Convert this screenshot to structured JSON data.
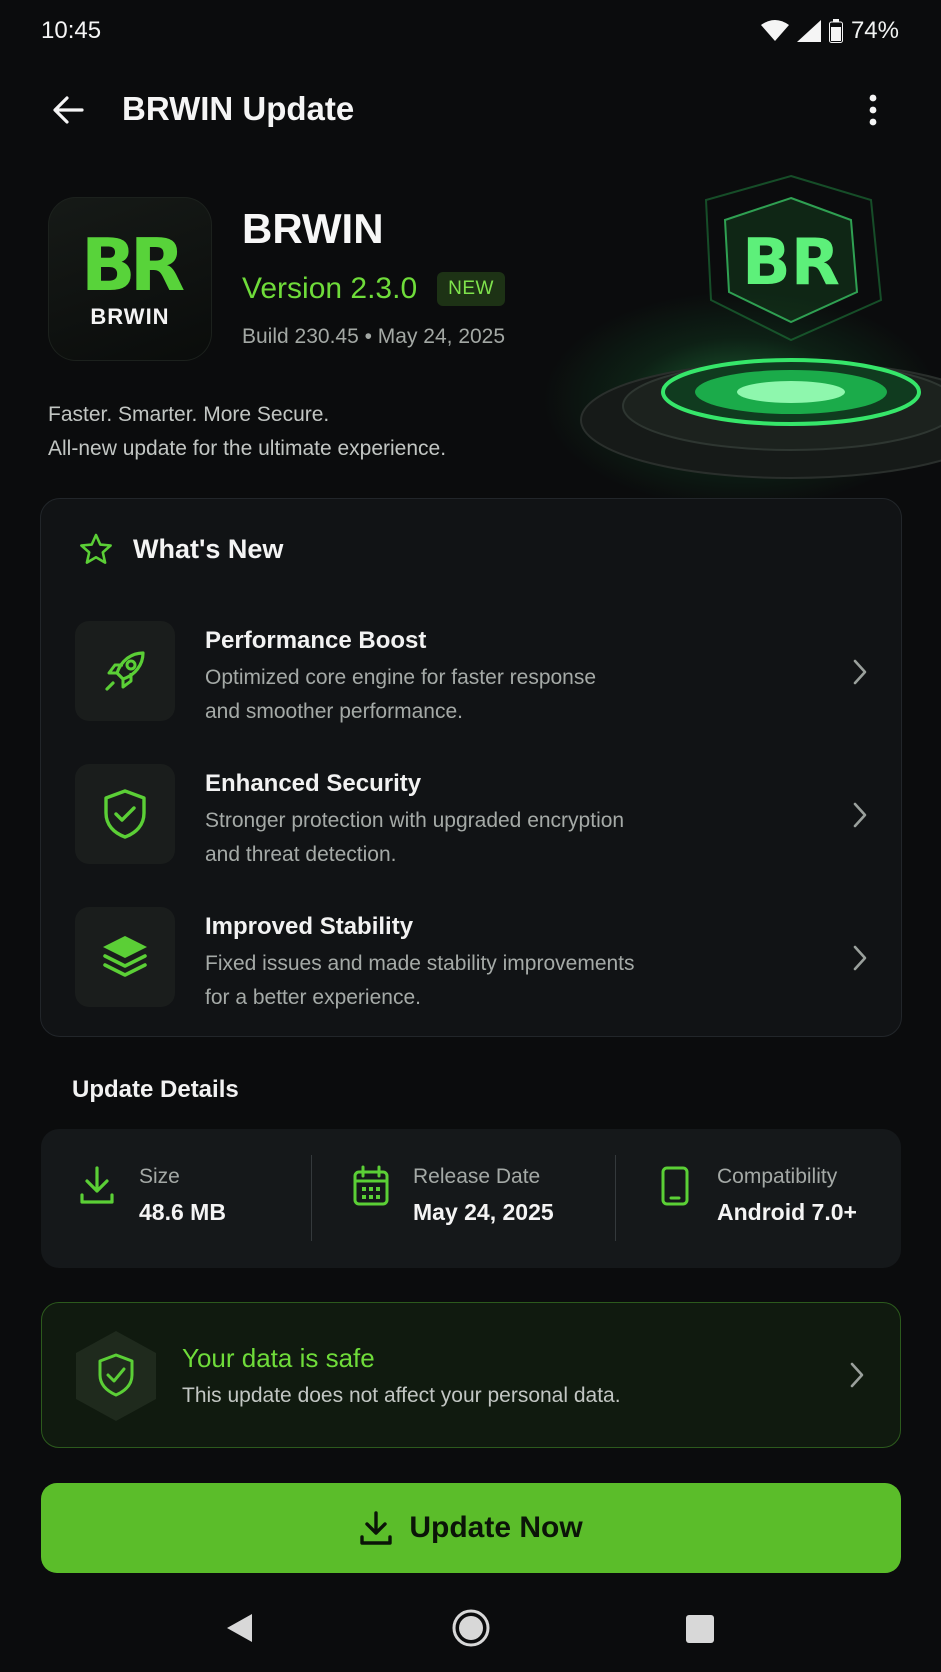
{
  "status_bar": {
    "time": "10:45",
    "battery": "74%"
  },
  "app_bar": {
    "title": "BRWIN Update"
  },
  "app": {
    "icon_monogram": "BR",
    "icon_word": "BRWIN",
    "name": "BRWIN",
    "version": "Version 2.3.0",
    "badge": "NEW",
    "build": "Build 230.45 • May 24, 2025",
    "tagline_1": "Faster. Smarter. More Secure.",
    "tagline_2": "All-new update for the ultimate experience."
  },
  "whats_new": {
    "title": "What's New",
    "items": [
      {
        "icon": "rocket-icon",
        "title": "Performance Boost",
        "desc_1": "Optimized core engine for faster response",
        "desc_2": "and smoother performance."
      },
      {
        "icon": "shield-check-icon",
        "title": "Enhanced Security",
        "desc_1": "Stronger protection with upgraded encryption",
        "desc_2": "and threat detection."
      },
      {
        "icon": "layers-icon",
        "title": "Improved Stability",
        "desc_1": "Fixed issues and made stability improvements",
        "desc_2": "for a better experience."
      }
    ]
  },
  "details": {
    "heading": "Update Details",
    "size_label": "Size",
    "size_value": "48.6 MB",
    "release_label": "Release Date",
    "release_value": "May 24, 2025",
    "compat_label": "Compatibility",
    "compat_value": "Android 7.0+"
  },
  "safe": {
    "title": "Your data is safe",
    "desc": "This update does not affect your personal data."
  },
  "update_button": {
    "label": "Update Now"
  },
  "colors": {
    "accent": "#5bbd2a",
    "accent_text": "#6fdc3a",
    "background": "#0b0c0d",
    "card": "#111315"
  }
}
